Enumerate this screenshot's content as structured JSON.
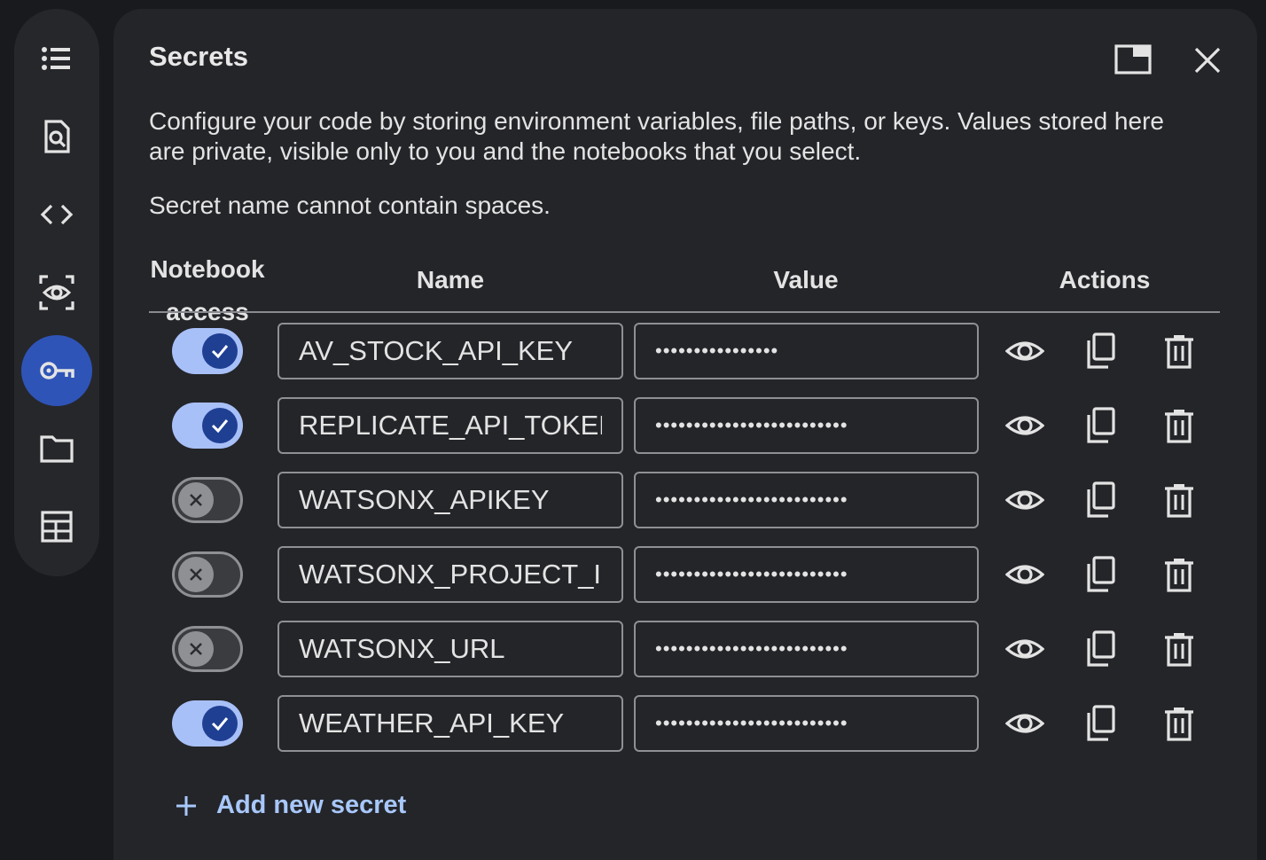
{
  "panel": {
    "title": "Secrets",
    "description": "Configure your code by storing environment variables, file paths, or keys. Values stored here are private, visible only to you and the notebooks that you select.",
    "note": "Secret name cannot contain spaces."
  },
  "table": {
    "headers": {
      "access_line1": "Notebook",
      "access_line2": "access",
      "name": "Name",
      "value": "Value",
      "actions": "Actions"
    },
    "rows": [
      {
        "enabled": true,
        "name": "AV_STOCK_API_KEY",
        "value_mask": "••••••••••••••••"
      },
      {
        "enabled": true,
        "name": "REPLICATE_API_TOKEN",
        "value_mask": "•••••••••••••••••••••••••"
      },
      {
        "enabled": false,
        "name": "WATSONX_APIKEY",
        "value_mask": "•••••••••••••••••••••••••"
      },
      {
        "enabled": false,
        "name": "WATSONX_PROJECT_ID",
        "value_mask": "•••••••••••••••••••••••••"
      },
      {
        "enabled": false,
        "name": "WATSONX_URL",
        "value_mask": "•••••••••••••••••••••••••"
      },
      {
        "enabled": true,
        "name": "WEATHER_API_KEY",
        "value_mask": "•••••••••••••••••••••••••"
      }
    ]
  },
  "add_button": {
    "label": "Add new secret"
  },
  "rail": {
    "items": [
      {
        "icon": "table-of-contents-icon",
        "active": false
      },
      {
        "icon": "find-in-page-icon",
        "active": false
      },
      {
        "icon": "code-snippets-icon",
        "active": false
      },
      {
        "icon": "variables-inspector-icon",
        "active": false
      },
      {
        "icon": "key-icon",
        "active": true
      },
      {
        "icon": "folder-icon",
        "active": false
      },
      {
        "icon": "table-icon",
        "active": false
      }
    ]
  },
  "colors": {
    "accent": "#a8c7fa",
    "active_rail": "#2f54b8",
    "toggle_on": "#a8c0f8",
    "panel_bg": "#242529"
  }
}
